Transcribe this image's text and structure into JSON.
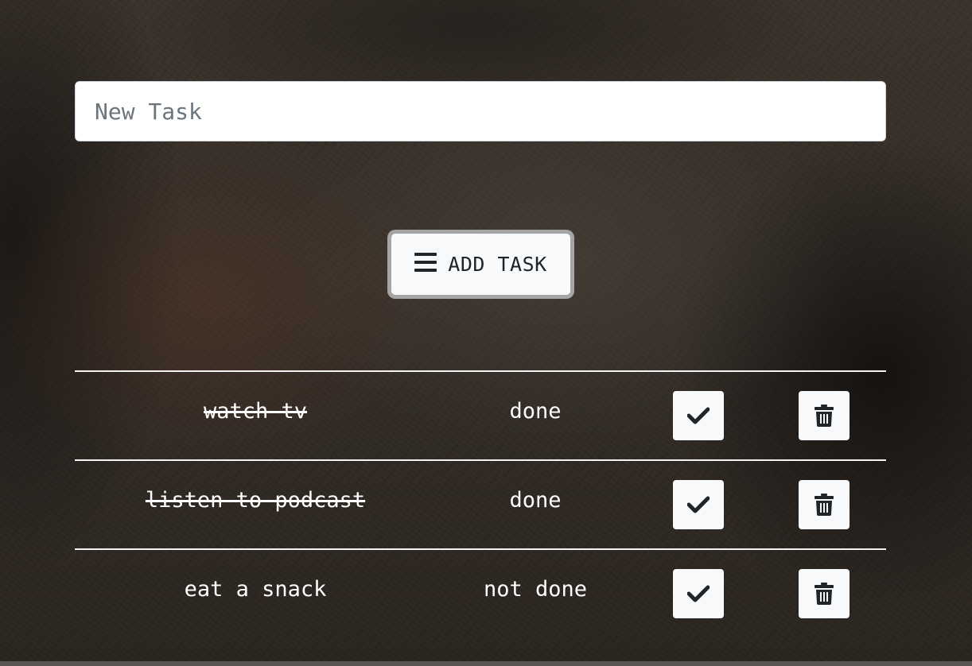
{
  "new_task": {
    "placeholder": "New Task",
    "value": ""
  },
  "add_button": {
    "label": "ADD TASK",
    "icon": "list-icon"
  },
  "tasks": [
    {
      "name": "watch tv",
      "status": "done",
      "done": true
    },
    {
      "name": "listen to podcast",
      "status": "done",
      "done": true
    },
    {
      "name": "eat a snack",
      "status": "not done",
      "done": false
    }
  ],
  "row_icons": {
    "complete": "check-icon",
    "delete": "trash-icon"
  },
  "colors": {
    "text": "#ffffff",
    "button_bg": "#f8f9fa",
    "icon": "#212529",
    "divider": "#f2f2f2"
  }
}
